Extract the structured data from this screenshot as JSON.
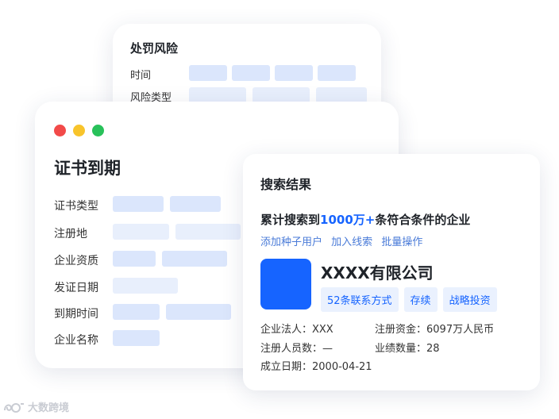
{
  "penalty_card": {
    "title": "处罚风险",
    "fields": [
      "时间",
      "风险类型"
    ]
  },
  "cert_card": {
    "window_controls": [
      "close",
      "minimize",
      "maximize"
    ],
    "title": "证书到期",
    "fields": [
      "证书类型",
      "注册地",
      "企业资质",
      "发证日期",
      "到期时间",
      "企业名称"
    ]
  },
  "result_card": {
    "section_title": "搜索结果",
    "summary_prefix": "累计搜索到",
    "summary_count": "1000万+",
    "summary_suffix": "条符合条件的企业",
    "actions": [
      "添加种子用户",
      "加入线索",
      "批量操作"
    ],
    "company": {
      "name": "XXXX有限公司",
      "tags": [
        "52条联系方式",
        "存续",
        "战略投资"
      ],
      "legal_person": "企业法人：XXX",
      "registered_capital": "注册资金：6097万人民币",
      "insured_staff": "注册人员数：—",
      "performance_count": "业绩数量：28",
      "founded": "成立日期：2000-04-21"
    },
    "colors": {
      "accent": "#1664ff",
      "tag_bg": "#eaf1fe"
    }
  },
  "watermark": {
    "text": "大数跨境"
  }
}
